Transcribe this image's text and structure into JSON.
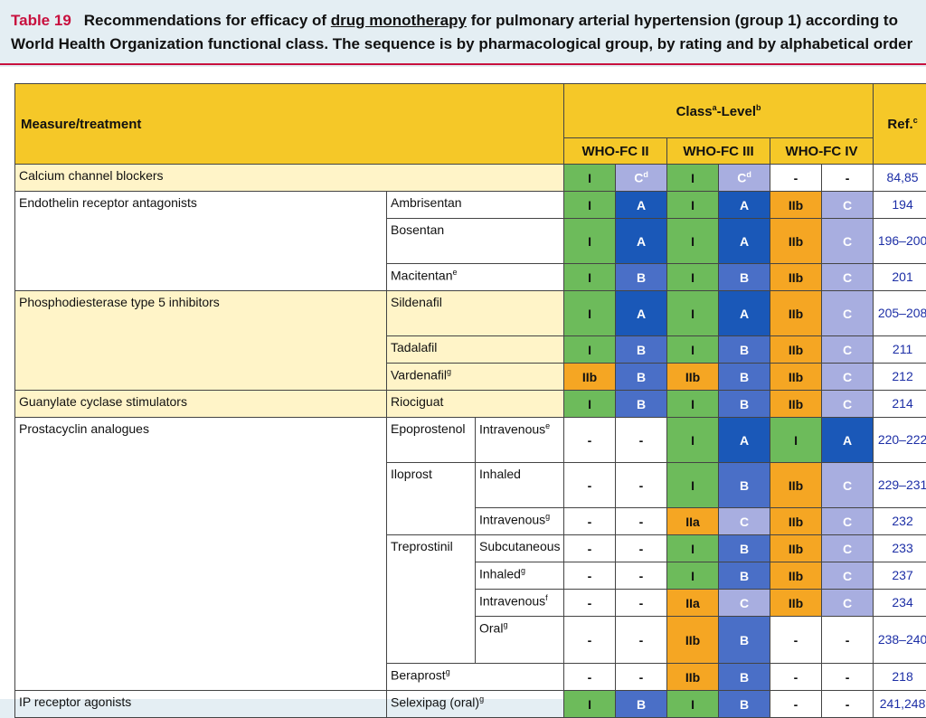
{
  "caption": {
    "label": "Table 19",
    "text_before": "Recommendations for efficacy of ",
    "text_underlined": "drug monotherapy",
    "text_after": " for pulmonary arterial hypertension (group 1) according to",
    "line2": "World Health Organization functional class. The sequence is by pharmacological group, by rating and by alphabetical order"
  },
  "header": {
    "measure": "Measure/treatment",
    "class_level": "Class",
    "class_sup": "a",
    "level": "-Level",
    "level_sup": "b",
    "ref": "Ref.",
    "ref_sup": "c",
    "fc2": "WHO-FC II",
    "fc3": "WHO-FC III",
    "fc4": "WHO-FC IV"
  },
  "rows": {
    "r0": {
      "g": "Calcium channel blockers",
      "c1": "I",
      "c2": "C",
      "c2sup": "d",
      "c3": "I",
      "c4": "C",
      "c4sup": "d",
      "c5": "-",
      "c6": "-",
      "ref": "84,85"
    },
    "r1": {
      "g": "Endothelin receptor antagonists",
      "d": "Ambrisentan",
      "c1": "I",
      "c2": "A",
      "c3": "I",
      "c4": "A",
      "c5": "IIb",
      "c6": "C",
      "ref": "194"
    },
    "r2": {
      "d": "Bosentan",
      "c1": "I",
      "c2": "A",
      "c3": "I",
      "c4": "A",
      "c5": "IIb",
      "c6": "C",
      "ref": "196–200"
    },
    "r3": {
      "d": "Macitentan",
      "dsup": "e",
      "c1": "I",
      "c2": "B",
      "c3": "I",
      "c4": "B",
      "c5": "IIb",
      "c6": "C",
      "ref": "201"
    },
    "r4": {
      "g": "Phosphodiesterase type 5 inhibitors",
      "d": "Sildenafil",
      "c1": "I",
      "c2": "A",
      "c3": "I",
      "c4": "A",
      "c5": "IIb",
      "c6": "C",
      "ref": "205–208"
    },
    "r5": {
      "d": "Tadalafil",
      "c1": "I",
      "c2": "B",
      "c3": "I",
      "c4": "B",
      "c5": "IIb",
      "c6": "C",
      "ref": "211"
    },
    "r6": {
      "d": "Vardenafil",
      "dsup": "g",
      "c1": "IIb",
      "c2": "B",
      "c3": "IIb",
      "c4": "B",
      "c5": "IIb",
      "c6": "C",
      "ref": "212"
    },
    "r7": {
      "g": "Guanylate cyclase stimulators",
      "d": "Riociguat",
      "c1": "I",
      "c2": "B",
      "c3": "I",
      "c4": "B",
      "c5": "IIb",
      "c6": "C",
      "ref": "214"
    },
    "r8": {
      "g": "Prostacyclin analogues",
      "d": "Epoprostenol",
      "r": "Intravenous",
      "rsup": "e",
      "c1": "-",
      "c2": "-",
      "c3": "I",
      "c4": "A",
      "c5": "I",
      "c6": "A",
      "ref": "220–222"
    },
    "r9": {
      "d": "Iloprost",
      "r": "Inhaled",
      "c1": "-",
      "c2": "-",
      "c3": "I",
      "c4": "B",
      "c5": "IIb",
      "c6": "C",
      "ref": "229–231"
    },
    "r10": {
      "r": "Intravenous",
      "rsup": "g",
      "c1": "-",
      "c2": "-",
      "c3": "IIa",
      "c4": "C",
      "c5": "IIb",
      "c6": "C",
      "ref": "232"
    },
    "r11": {
      "d": "Treprostinil",
      "r": "Subcutaneous",
      "c1": "-",
      "c2": "-",
      "c3": "I",
      "c4": "B",
      "c5": "IIb",
      "c6": "C",
      "ref": "233"
    },
    "r12": {
      "r": "Inhaled",
      "rsup": "g",
      "c1": "-",
      "c2": "-",
      "c3": "I",
      "c4": "B",
      "c5": "IIb",
      "c6": "C",
      "ref": "237"
    },
    "r13": {
      "r": "Intravenous",
      "rsup": "f",
      "c1": "-",
      "c2": "-",
      "c3": "IIa",
      "c4": "C",
      "c5": "IIb",
      "c6": "C",
      "ref": "234"
    },
    "r14": {
      "r": "Oral",
      "rsup": "g",
      "c1": "-",
      "c2": "-",
      "c3": "IIb",
      "c4": "B",
      "c5": "-",
      "c6": "-",
      "ref": "238–240"
    },
    "r15": {
      "d": "Beraprost",
      "dsup": "g",
      "c1": "-",
      "c2": "-",
      "c3": "IIb",
      "c4": "B",
      "c5": "-",
      "c6": "-",
      "ref": "218"
    },
    "r16": {
      "g": "IP receptor agonists",
      "d": "Selexipag (oral)",
      "dsup": "g",
      "c1": "I",
      "c2": "B",
      "c3": "I",
      "c4": "B",
      "c5": "-",
      "c6": "-",
      "ref": "241,248"
    }
  },
  "colors": {
    "class_I": "#6dbb5b",
    "class_II": "#f5a623",
    "level_A": "#1a58b8",
    "level_B": "#4a6fc7",
    "level_C": "#a8aee0",
    "header_bg": "#f5c828",
    "group_row_bg": "#fff4c8",
    "ref_text": "#1d2fa6",
    "caption_accent": "#c8103e"
  }
}
